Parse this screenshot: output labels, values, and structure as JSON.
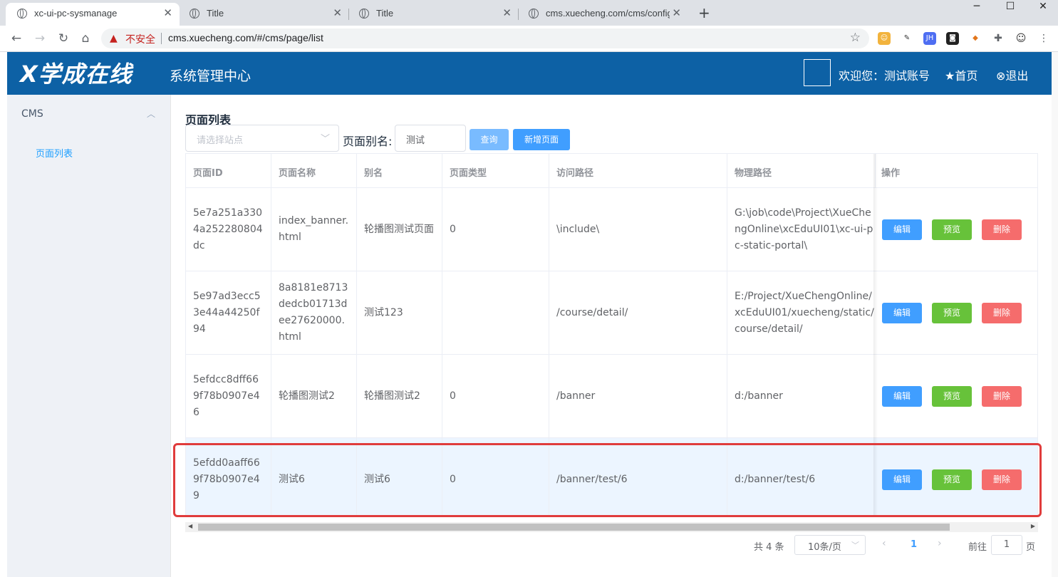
{
  "browser": {
    "tabs": [
      {
        "title": "xc-ui-pc-sysmanage"
      },
      {
        "title": "Title"
      },
      {
        "title": "Title"
      },
      {
        "title": "cms.xuecheng.com/cms/config"
      }
    ],
    "new_tab": "+",
    "security_label": "不安全",
    "url": "cms.xuecheng.com/#/cms/page/list"
  },
  "header": {
    "logo": "X学成在线",
    "subtitle": "系统管理中心",
    "welcome": "欢迎您：测试账号",
    "home": "首页",
    "logout": "退出"
  },
  "sidebar": {
    "menu": "CMS",
    "items": [
      {
        "label": "页面列表"
      }
    ]
  },
  "main": {
    "title": "页面列表",
    "site_placeholder": "请选择站点",
    "alias_label": "页面别名:",
    "alias_value": "测试",
    "query_button": "查询",
    "new_button": "新增页面"
  },
  "table": {
    "columns": [
      "页面ID",
      "页面名称",
      "别名",
      "页面类型",
      "访问路径",
      "物理路径",
      "操作"
    ],
    "rows": [
      {
        "id": "5e7a251a3304a252280804dc",
        "name": "index_banner.html",
        "alias": "轮播图测试页面",
        "type": "0",
        "access_path": "\\include\\",
        "physical_path": "G:\\job\\code\\Project\\XueChengOnline\\xcEduUI01\\xc-ui-pc-static-portal\\"
      },
      {
        "id": "5e97ad3ecc53e44a44250f94",
        "name": "8a8181e8713dedcb01713dee27620000.html",
        "alias": "测试123",
        "type": "",
        "access_path": "/course/detail/",
        "physical_path": "E:/Project/XueChengOnline/xcEduUI01/xuecheng/static/course/detail/"
      },
      {
        "id": "5efdcc8dff669f78b0907e46",
        "name": "轮播图测试2",
        "alias": "轮播图测试2",
        "type": "0",
        "access_path": "/banner",
        "physical_path": "d:/banner"
      },
      {
        "id": "5efdd0aaff669f78b0907e49",
        "name": "测试6",
        "alias": "测试6",
        "type": "0",
        "access_path": "/banner/test/6",
        "physical_path": "d:/banner/test/6"
      }
    ],
    "actions": {
      "edit": "编辑",
      "preview": "预览",
      "delete": "删除"
    }
  },
  "pagination": {
    "total": "共 4 条",
    "page_size": "10条/页",
    "current_page": "1",
    "goto_label": "前往",
    "goto_value": "1",
    "goto_unit": "页"
  }
}
